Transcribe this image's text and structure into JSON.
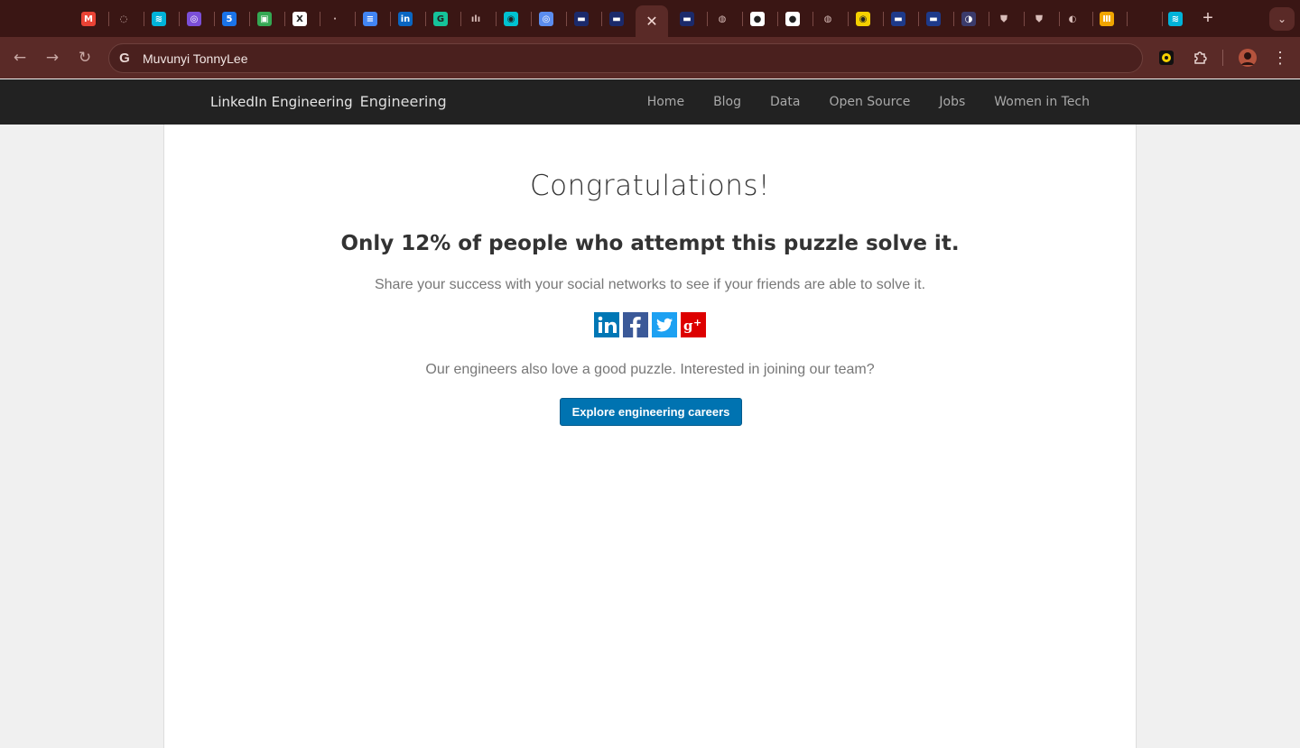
{
  "browser": {
    "tabs": [
      {
        "icon": "gmail-icon",
        "glyph": "M",
        "color": "#ea4335"
      },
      {
        "icon": "circle-dash-icon",
        "glyph": "◌",
        "color": "transparent"
      },
      {
        "icon": "streamlit-icon",
        "glyph": "≋",
        "color": "#00b3d9"
      },
      {
        "icon": "purple-app-icon",
        "glyph": "◎",
        "color": "#7b4fd8"
      },
      {
        "icon": "calendar-icon",
        "glyph": "5",
        "color": "#1a73e8"
      },
      {
        "icon": "google-meet-icon",
        "glyph": "▣",
        "color": "#34a853"
      },
      {
        "icon": "x-icon",
        "glyph": "X",
        "color": "#ffffff"
      },
      {
        "icon": "dark-app-icon",
        "glyph": "·",
        "color": "transparent"
      },
      {
        "icon": "docs-icon",
        "glyph": "≡",
        "color": "#4285f4"
      },
      {
        "icon": "linkedin-icon",
        "glyph": "in",
        "color": "#0a66c2"
      },
      {
        "icon": "grammarly-icon",
        "glyph": "G",
        "color": "#15c39a"
      },
      {
        "icon": "chart-app-icon",
        "glyph": "ılı",
        "color": "transparent"
      },
      {
        "icon": "cyan-app-icon",
        "glyph": "◉",
        "color": "#00c2d1"
      },
      {
        "icon": "target-app-icon",
        "glyph": "◎",
        "color": "#5b8def"
      },
      {
        "icon": "navy-app-icon",
        "glyph": "▬",
        "color": "#1b2a6b"
      },
      {
        "icon": "navy-app-icon",
        "glyph": "▬",
        "color": "#1b2a6b"
      },
      {
        "icon": "navy-app-icon",
        "glyph": "▬",
        "color": "#1b2a6b"
      },
      {
        "icon": "github-copilot-icon",
        "glyph": "◍",
        "color": "transparent"
      },
      {
        "icon": "github-icon",
        "glyph": "●",
        "color": "#ffffff"
      },
      {
        "icon": "github-icon",
        "glyph": "●",
        "color": "#ffffff"
      },
      {
        "icon": "github-copilot-icon",
        "glyph": "◍",
        "color": "transparent"
      },
      {
        "icon": "yellow-app-icon",
        "glyph": "◉",
        "color": "#f5d000"
      },
      {
        "icon": "blue-app-icon",
        "glyph": "▬",
        "color": "#1e3a8a"
      },
      {
        "icon": "blue-app-icon",
        "glyph": "▬",
        "color": "#1e3a8a"
      },
      {
        "icon": "globe-app-icon",
        "glyph": "◑",
        "color": "#3b3b6b"
      },
      {
        "icon": "shield-app-icon",
        "glyph": "⛊",
        "color": "transparent"
      },
      {
        "icon": "shield-app-icon",
        "glyph": "⛊",
        "color": "transparent"
      },
      {
        "icon": "globe-icon",
        "glyph": "◐",
        "color": "transparent"
      },
      {
        "icon": "orange-app-icon",
        "glyph": "Ⅲ",
        "color": "#f0a500"
      },
      {
        "icon": "blank-tab-icon",
        "glyph": "",
        "color": "transparent"
      },
      {
        "icon": "streamlit-icon",
        "glyph": "≋",
        "color": "#00b3d9"
      }
    ],
    "active_tab_close": "✕",
    "new_tab": "+",
    "omnibox_text": "Muvunyi TonnyLee"
  },
  "site": {
    "logo_alt": "LinkedIn Engineering",
    "brand_name": "Engineering",
    "nav": [
      "Home",
      "Blog",
      "Data",
      "Open Source",
      "Jobs",
      "Women in Tech"
    ]
  },
  "main": {
    "title": "Congratulations!",
    "subtitle": "Only 12% of people who attempt this puzzle solve it.",
    "share_text": "Share your success with your social networks to see if your friends are able to solve it.",
    "social": [
      {
        "name": "linkedin",
        "glyph": "in",
        "color": "#0077b5"
      },
      {
        "name": "facebook",
        "glyph": "f",
        "color": "#3b5998"
      },
      {
        "name": "twitter",
        "glyph": "🐦",
        "color": "#1da1f2"
      },
      {
        "name": "google-plus",
        "glyph": "g+",
        "color": "#dd0000"
      }
    ],
    "careers_text": "Our engineers also love a good puzzle. Interested in joining our team?",
    "cta_label": "Explore engineering careers"
  }
}
